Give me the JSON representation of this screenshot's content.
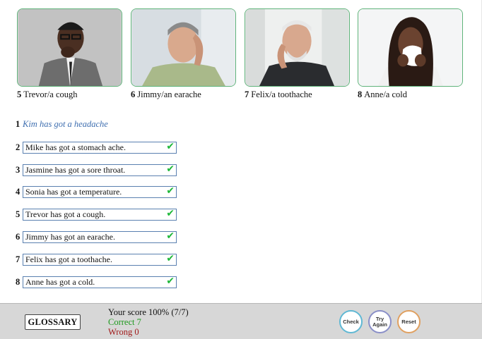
{
  "photos": [
    {
      "number": "5",
      "caption": "Trevor/a cough"
    },
    {
      "number": "6",
      "caption": "Jimmy/an earache"
    },
    {
      "number": "7",
      "caption": "Felix/a toothache"
    },
    {
      "number": "8",
      "caption": "Anne/a cold"
    }
  ],
  "example": {
    "number": "1",
    "text": "Kim has got a headache"
  },
  "answers": [
    {
      "number": "2",
      "value": "Mike has got a stomach ache."
    },
    {
      "number": "3",
      "value": "Jasmine has got a sore throat."
    },
    {
      "number": "4",
      "value": "Sonia has got a temperature."
    },
    {
      "number": "5",
      "value": "Trevor has got a cough."
    },
    {
      "number": "6",
      "value": "Jimmy has got an earache."
    },
    {
      "number": "7",
      "value": "Felix has got a toothache."
    },
    {
      "number": "8",
      "value": "Anne has got a cold."
    }
  ],
  "footer": {
    "glossary": "GLOSSARY",
    "score": "Your score 100% (7/7)",
    "correct": "Correct 7",
    "wrong": "Wrong 0",
    "check": "Check",
    "try_again_1": "Try",
    "try_again_2": "Again",
    "reset": "Reset"
  },
  "colors": {
    "correct_mark": "#1fb83a",
    "photo_border": "#5fb37a",
    "example_text": "#3f6fb0"
  }
}
